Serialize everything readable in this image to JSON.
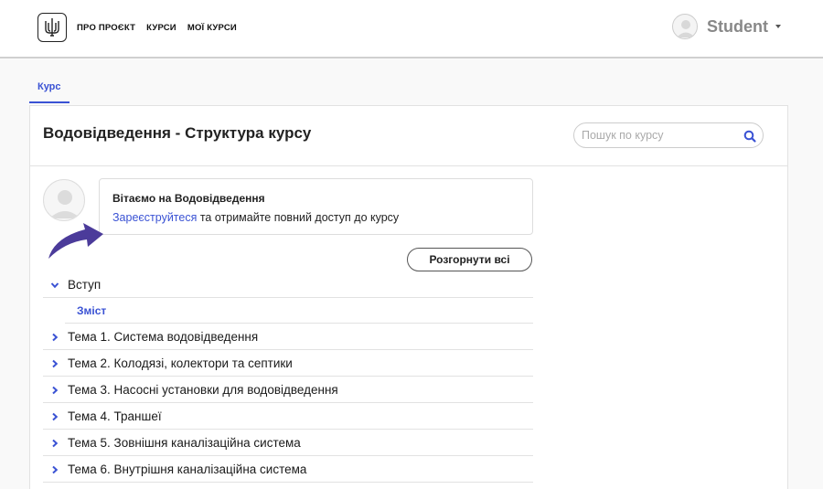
{
  "header": {
    "nav": [
      "ПРО ПРОЄКТ",
      "КУРСИ",
      "МОЇ КУРСИ"
    ],
    "username": "Student"
  },
  "tabs": [
    "Курс"
  ],
  "course": {
    "title": "Водовідведення - Структура курсу",
    "search_placeholder": "Пошук по курсу"
  },
  "welcome": {
    "title": "Вітаємо на Водовідведення",
    "register_link": "Зареєструйтеся",
    "rest": " та отримайте повний доступ до курсу"
  },
  "expand_all": "Розгорнути всі",
  "sections": [
    {
      "label": "Вступ",
      "expanded": true,
      "children": [
        "Зміст"
      ]
    },
    {
      "label": "Тема 1. Система водовідведення",
      "expanded": false
    },
    {
      "label": "Тема 2. Колодязі, колектори та септики",
      "expanded": false
    },
    {
      "label": "Тема 3. Насосні установки для водовідведення",
      "expanded": false
    },
    {
      "label": "Тема 4. Траншеї",
      "expanded": false
    },
    {
      "label": "Тема 5. Зовнішня каналізаційна система",
      "expanded": false
    },
    {
      "label": "Тема 6. Внутрішня каналізаційна система",
      "expanded": false
    }
  ],
  "colors": {
    "accent": "#3a52d4",
    "arrow": "#4b3b9a"
  }
}
